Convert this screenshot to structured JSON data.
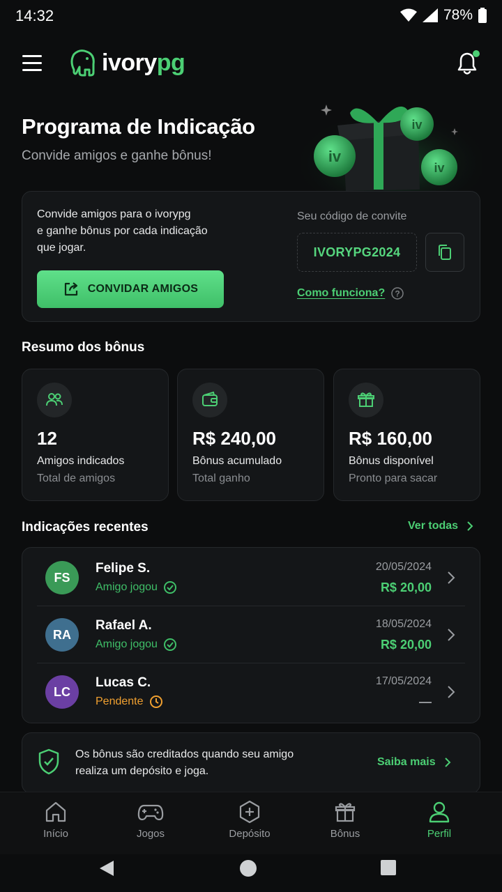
{
  "status_bar": {
    "time": "14:32",
    "battery": "78%"
  },
  "header": {
    "logo_main": "ivory",
    "logo_accent": "pg"
  },
  "hero": {
    "title": "Programa de Indicação",
    "subtitle": "Convide amigos e ganhe bônus!"
  },
  "invite": {
    "text_line1": "Convide amigos para o ivorypg",
    "text_line2": "e ganhe bônus por cada indicação",
    "text_line3": "que jogar.",
    "button_label": "CONVIDAR AMIGOS",
    "code_label": "Seu código de convite",
    "code": "IVORYPG2024",
    "how_link": "Como funciona?"
  },
  "summary": {
    "title": "Resumo dos bônus",
    "stats": [
      {
        "value": "12",
        "label": "Amigos indicados",
        "sub": "Total de amigos",
        "icon": "friends-icon"
      },
      {
        "value": "R$ 240,00",
        "label": "Bônus acumulado",
        "sub": "Total ganho",
        "icon": "wallet-icon"
      },
      {
        "value": "R$ 160,00",
        "label": "Bônus disponível",
        "sub": "Pronto para sacar",
        "icon": "gift-icon"
      }
    ]
  },
  "recent": {
    "title": "Indicações recentes",
    "see_all": "Ver todas",
    "items": [
      {
        "initials": "FS",
        "name": "Felipe S.",
        "status": "Amigo jogou",
        "date": "20/05/2024",
        "amount": "R$ 20,00",
        "avatar_color": "#3a9a57",
        "status_color": "#3fbf68"
      },
      {
        "initials": "RA",
        "name": "Rafael A.",
        "status": "Amigo jogou",
        "date": "18/05/2024",
        "amount": "R$ 20,00",
        "avatar_color": "#3f6f8f",
        "status_color": "#3fbf68"
      },
      {
        "initials": "LC",
        "name": "Lucas C.",
        "status": "Pendente",
        "date": "17/05/2024",
        "amount": "—",
        "avatar_color": "#6b3fa3",
        "status_color": "#f0a030"
      }
    ]
  },
  "info": {
    "line1": "Os bônus são creditados quando seu amigo",
    "line2": "realiza um depósito e joga.",
    "link": "Saiba mais"
  },
  "nav": {
    "items": [
      {
        "label": "Início",
        "icon": "home-icon"
      },
      {
        "label": "Jogos",
        "icon": "gamepad-icon"
      },
      {
        "label": "Depósito",
        "icon": "deposit-icon"
      },
      {
        "label": "Bônus",
        "icon": "gift-icon"
      },
      {
        "label": "Perfil",
        "icon": "profile-icon"
      }
    ],
    "active": "Perfil"
  },
  "colors": {
    "accent": "#4ccf74",
    "background": "#0c0d0e",
    "card": "#141618",
    "pending": "#f0a030"
  }
}
